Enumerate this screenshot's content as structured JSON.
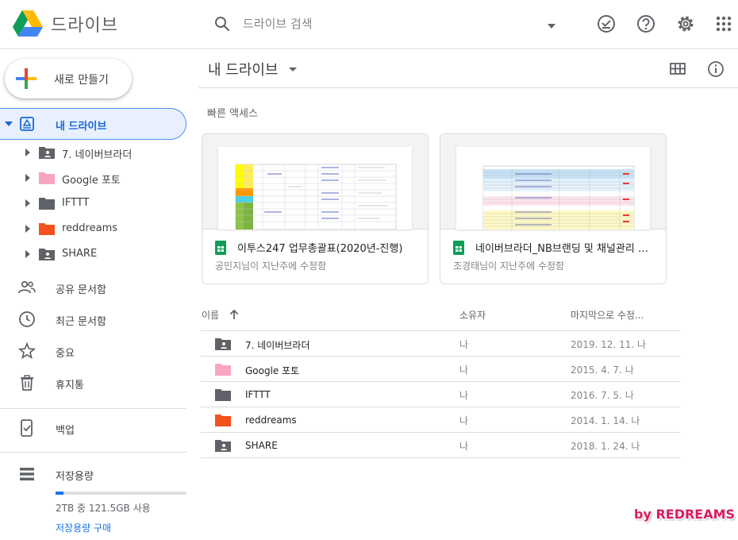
{
  "header": {
    "app_title": "드라이브",
    "search_placeholder": "드라이브 검색",
    "icons": [
      "drive-logo-icon",
      "search-icon",
      "search-options-caret",
      "offline-check-icon",
      "help-icon",
      "gear-icon",
      "apps-grid-icon"
    ]
  },
  "sidebar": {
    "new_button": "새로 만들기",
    "my_drive": "내 드라이브",
    "tree": [
      {
        "label": "7. 네이버브라더",
        "icon": "shared-folder-icon",
        "color": "#5f6368"
      },
      {
        "label": "Google 포토",
        "icon": "folder-icon",
        "color": "#f8a5c2"
      },
      {
        "label": "IFTTT",
        "icon": "folder-icon",
        "color": "#5f6368"
      },
      {
        "label": "reddreams",
        "icon": "folder-icon",
        "color": "#f4511e"
      },
      {
        "label": "SHARE",
        "icon": "shared-folder-icon",
        "color": "#5f6368"
      }
    ],
    "nav": [
      {
        "label": "공유 문서함",
        "icon": "people-icon"
      },
      {
        "label": "최근 문서함",
        "icon": "clock-icon"
      },
      {
        "label": "중요",
        "icon": "star-icon"
      },
      {
        "label": "휴지통",
        "icon": "trash-icon"
      },
      {
        "label": "백업",
        "icon": "backup-phone-icon"
      },
      {
        "label": "저장용량",
        "icon": "storage-icon"
      }
    ],
    "storage_text": "2TB 중 121.5GB 사용",
    "storage_fraction": 0.06,
    "storage_buy": "저장용량 구매"
  },
  "main": {
    "title": "내 드라이브",
    "quick_access_title": "빠른 액세스",
    "quick_access": [
      {
        "name": "이투스247 업무총괄표(2020년-진행)",
        "sub": "공민지님이 지난주에 수정함"
      },
      {
        "name": "네이버브라더_NB브랜딩 및 채널관리 매뉴얼",
        "sub": "조경태님이 지난주에 수정함"
      }
    ],
    "columns": {
      "name": "이름",
      "owner": "소유자",
      "modified": "마지막으로 수정..."
    },
    "files": [
      {
        "name": "7. 네이버브라더",
        "owner": "나",
        "modified": "2019. 12. 11. 나",
        "color": "#5f6368",
        "shared": true
      },
      {
        "name": "Google 포토",
        "owner": "나",
        "modified": "2015. 4. 7. 나",
        "color": "#f8a5c2",
        "shared": false
      },
      {
        "name": "IFTTT",
        "owner": "나",
        "modified": "2016. 7. 5. 나",
        "color": "#5f6368",
        "shared": false
      },
      {
        "name": "reddreams",
        "owner": "나",
        "modified": "2014. 1. 14. 나",
        "color": "#f4511e",
        "shared": false
      },
      {
        "name": "SHARE",
        "owner": "나",
        "modified": "2018. 1. 24. 나",
        "color": "#5f6368",
        "shared": true
      }
    ]
  },
  "watermark": "by REDREAMS",
  "colors": {
    "accent": "#1a73e8",
    "selected_bg": "#e8f0fe",
    "sheets_green": "#0f9d58"
  }
}
